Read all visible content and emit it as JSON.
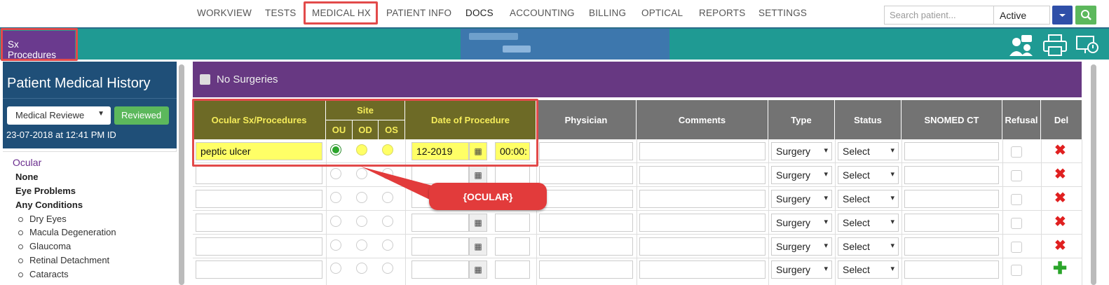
{
  "nav": {
    "items": [
      "WORKVIEW",
      "TESTS",
      "MEDICAL HX",
      "PATIENT INFO",
      "DOCS",
      "ACCOUNTING",
      "BILLING",
      "OPTICAL",
      "REPORTS",
      "SETTINGS"
    ],
    "active": "MEDICAL HX"
  },
  "search": {
    "placeholder": "Search patient...",
    "status_value": "Active"
  },
  "subbar": {
    "tab_label": "Sx Procedures"
  },
  "sidebar": {
    "title": "Patient Medical History",
    "review_dropdown": "Medical Reviewe",
    "reviewed_button": "Reviewed",
    "date_text": "23-07-2018 at 12:41 PM ID",
    "category": "Ocular",
    "items": [
      "None",
      "Eye Problems",
      "Any Conditions"
    ],
    "sub_items": [
      "Dry Eyes",
      "Macula Degeneration",
      "Glaucoma",
      "Retinal Detachment",
      "Cataracts"
    ]
  },
  "surgeries": {
    "no_surgeries_label": "No Surgeries"
  },
  "table": {
    "headers": {
      "procedure": "Ocular Sx/Procedures",
      "site": "Site",
      "site_ou": "OU",
      "site_od": "OD",
      "site_os": "OS",
      "date": "Date of Procedure",
      "physician": "Physician",
      "comments": "Comments",
      "type": "Type",
      "status": "Status",
      "snomed": "SNOMED CT",
      "refusal": "Refusal",
      "del": "Del"
    },
    "rows": [
      {
        "procedure": "peptic ulcer",
        "site": "OU",
        "date": "12-2019",
        "time": "00:00:",
        "type": "Surgery",
        "status": "Select"
      },
      {
        "procedure": "",
        "site": "",
        "date": "",
        "time": "",
        "type": "Surgery",
        "status": "Select"
      },
      {
        "procedure": "",
        "site": "",
        "date": "",
        "time": "",
        "type": "Surgery",
        "status": "Select"
      },
      {
        "procedure": "",
        "site": "",
        "date": "",
        "time": "",
        "type": "Surgery",
        "status": "Select"
      },
      {
        "procedure": "",
        "site": "",
        "date": "",
        "time": "",
        "type": "Surgery",
        "status": "Select"
      },
      {
        "procedure": "",
        "site": "",
        "date": "",
        "time": "",
        "type": "Surgery",
        "status": "Select"
      }
    ]
  },
  "callout": {
    "label": "{OCULAR}"
  },
  "colors": {
    "teal": "#1f9a93",
    "purple": "#673882",
    "olive_header": "#6d6a26",
    "highlight": "#ffff66",
    "annotation_red": "#e24a4a"
  }
}
